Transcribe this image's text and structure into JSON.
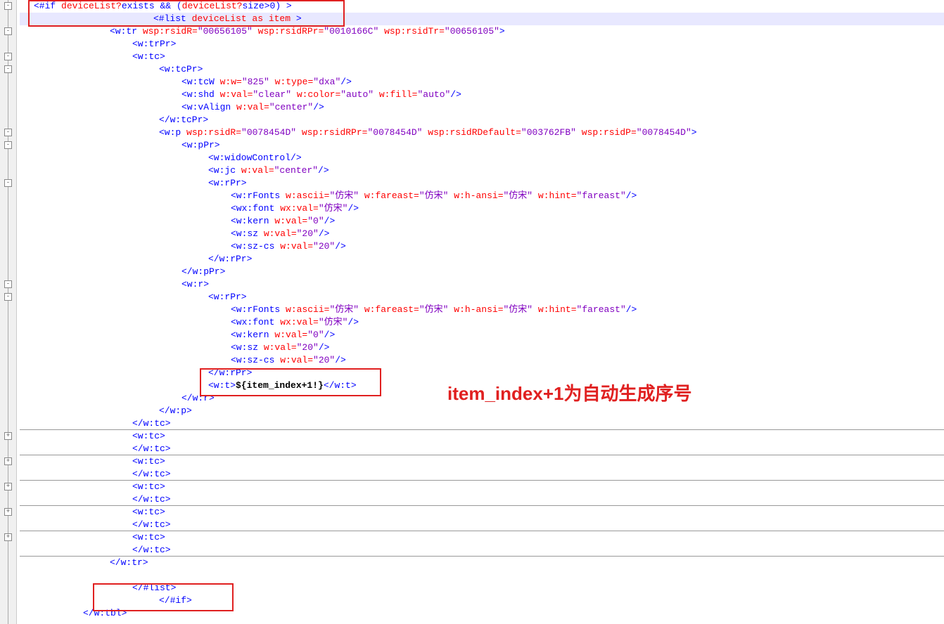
{
  "lines": {
    "l1_a": "<#if ",
    "l1_b": "deviceList?",
    "l1_c": "exists",
    "l1_d": " && (",
    "l1_e": "deviceList?",
    "l1_f": "size",
    "l1_g": ">0) >",
    "l2_a": "<#list ",
    "l2_b": "deviceList as item",
    "l2_c": " >",
    "l3_a": "<w:tr ",
    "l3_b": "wsp:rsidR=",
    "l3_c": "\"00656105\"",
    "l3_d": " wsp:rsidRPr=",
    "l3_e": "\"0010166C\"",
    "l3_f": " wsp:rsidTr=",
    "l3_g": "\"00656105\"",
    "l3_h": ">",
    "l4": "<w:trPr>",
    "l5": "<w:tc>",
    "l6": "<w:tcPr>",
    "l7_a": "<w:tcW ",
    "l7_b": "w:w=",
    "l7_c": "\"825\"",
    "l7_d": " w:type=",
    "l7_e": "\"dxa\"",
    "l7_f": "/>",
    "l8_a": "<w:shd ",
    "l8_b": "w:val=",
    "l8_c": "\"clear\"",
    "l8_d": " w:color=",
    "l8_e": "\"auto\"",
    "l8_f": " w:fill=",
    "l8_g": "\"auto\"",
    "l8_h": "/>",
    "l9_a": "<w:vAlign ",
    "l9_b": "w:val=",
    "l9_c": "\"center\"",
    "l9_d": "/>",
    "l10": "</w:tcPr>",
    "l11_a": "<w:p ",
    "l11_b": "wsp:rsidR=",
    "l11_c": "\"0078454D\"",
    "l11_d": " wsp:rsidRPr=",
    "l11_e": "\"0078454D\"",
    "l11_f": " wsp:rsidRDefault=",
    "l11_g": "\"003762FB\"",
    "l11_h": " wsp:rsidP=",
    "l11_i": "\"0078454D\"",
    "l11_j": ">",
    "l12": "<w:pPr>",
    "l13": "<w:widowControl/>",
    "l14_a": "<w:jc ",
    "l14_b": "w:val=",
    "l14_c": "\"center\"",
    "l14_d": "/>",
    "l15": "<w:rPr>",
    "l16_a": "<w:rFonts ",
    "l16_b": "w:ascii=",
    "l16_c": "\"仿宋\"",
    "l16_d": " w:fareast=",
    "l16_e": "\"仿宋\"",
    "l16_f": " w:h-ansi=",
    "l16_g": "\"仿宋\"",
    "l16_h": " w:hint=",
    "l16_i": "\"fareast\"",
    "l16_j": "/>",
    "l17_a": "<wx:font ",
    "l17_b": "wx:val=",
    "l17_c": "\"仿宋\"",
    "l17_d": "/>",
    "l18_a": "<w:kern ",
    "l18_b": "w:val=",
    "l18_c": "\"0\"",
    "l18_d": "/>",
    "l19_a": "<w:sz ",
    "l19_b": "w:val=",
    "l19_c": "\"20\"",
    "l19_d": "/>",
    "l20_a": "<w:sz-cs ",
    "l20_b": "w:val=",
    "l20_c": "\"20\"",
    "l20_d": "/>",
    "l21": "</w:rPr>",
    "l22": "</w:pPr>",
    "l23": "<w:r>",
    "l24": "<w:rPr>",
    "l25": "</w:rPr>",
    "l26_a": "<w:t>",
    "l26_b": "${item_index+1!}",
    "l26_c": "</w:t>",
    "l27": "</w:r>",
    "l28": "</w:p>",
    "l29": "</w:tc>",
    "l30": "<w:tc>",
    "l31": "</w:tc>",
    "l40": "</w:tr>",
    "l41": "</#list>",
    "l42": "</#if>",
    "l43": "</w:tbl>"
  },
  "annotation": "item_index+1为自动生成序号"
}
